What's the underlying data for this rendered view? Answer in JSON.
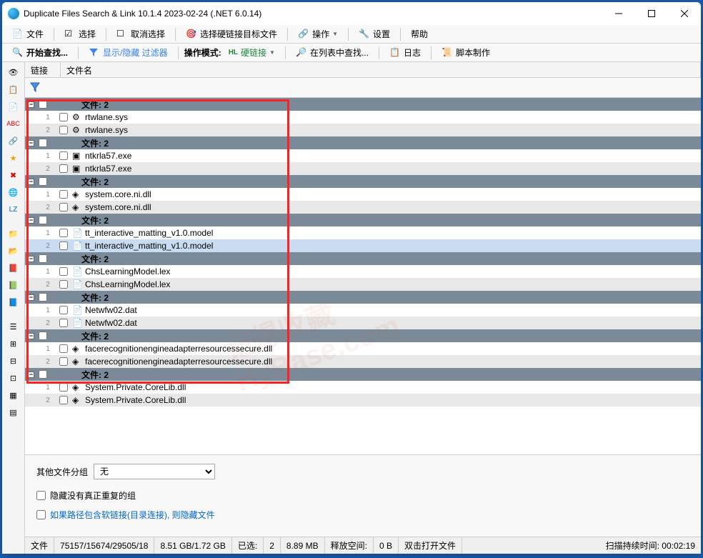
{
  "window": {
    "title": "Duplicate Files Search & Link 10.1.4 2023-02-24 (.NET 6.0.14)"
  },
  "toolbar1": {
    "file": "文件",
    "select": "选择",
    "deselect": "取消选择",
    "hardlink_target": "选择硬链接目标文件",
    "operate": "操作",
    "settings": "设置",
    "help": "帮助"
  },
  "toolbar2": {
    "start_search": "开始查找...",
    "show_hide_filter": "显示/隐藏 过滤器",
    "op_mode": "操作模式:",
    "hardlink": "硬链接",
    "find_in_list": "在列表中查找...",
    "log": "日志",
    "script": "脚本制作"
  },
  "columns": {
    "link": "链接",
    "filename": "文件名"
  },
  "group_label": "文件: 2",
  "groups": [
    {
      "files": [
        "rtwlane.sys",
        "rtwlane.sys"
      ],
      "icon": "sys"
    },
    {
      "files": [
        "ntkrla57.exe",
        "ntkrla57.exe"
      ],
      "icon": "exe"
    },
    {
      "files": [
        "system.core.ni.dll",
        "system.core.ni.dll"
      ],
      "icon": "dll"
    },
    {
      "files": [
        "tt_interactive_matting_v1.0.model",
        "tt_interactive_matting_v1.0.model"
      ],
      "icon": "file",
      "sel": 1
    },
    {
      "files": [
        "ChsLearningModel.lex",
        "ChsLearningModel.lex"
      ],
      "icon": "file"
    },
    {
      "files": [
        "Netwfw02.dat",
        "Netwfw02.dat"
      ],
      "icon": "file"
    },
    {
      "files": [
        "facerecognitionengineadapterresourcessecure.dll",
        "facerecognitionengineadapterresourcessecure.dll"
      ],
      "icon": "dll"
    },
    {
      "files": [
        "System.Private.CoreLib.dll",
        "System.Private.CoreLib.dll"
      ],
      "icon": "dll"
    }
  ],
  "bottom": {
    "other_group": "其他文件分组",
    "other_group_val": "无",
    "hide_no_dup": "隐藏没有真正重复的组",
    "hide_symlink": "如果路径包含软链接(目录连接), 则隐藏文件"
  },
  "status": {
    "files_lbl": "文件",
    "counts": "75157/15674/29505/18",
    "size": "8.51 GB/1.72 GB",
    "selected_lbl": "已选:",
    "sel_count": "2",
    "sel_size": "8.89 MB",
    "free_lbl": "释放空间:",
    "free_val": "0 B",
    "dbl_click": "双击打开文件",
    "scan_time_lbl": "扫描持续时间:",
    "scan_time": "00:02:19"
  }
}
